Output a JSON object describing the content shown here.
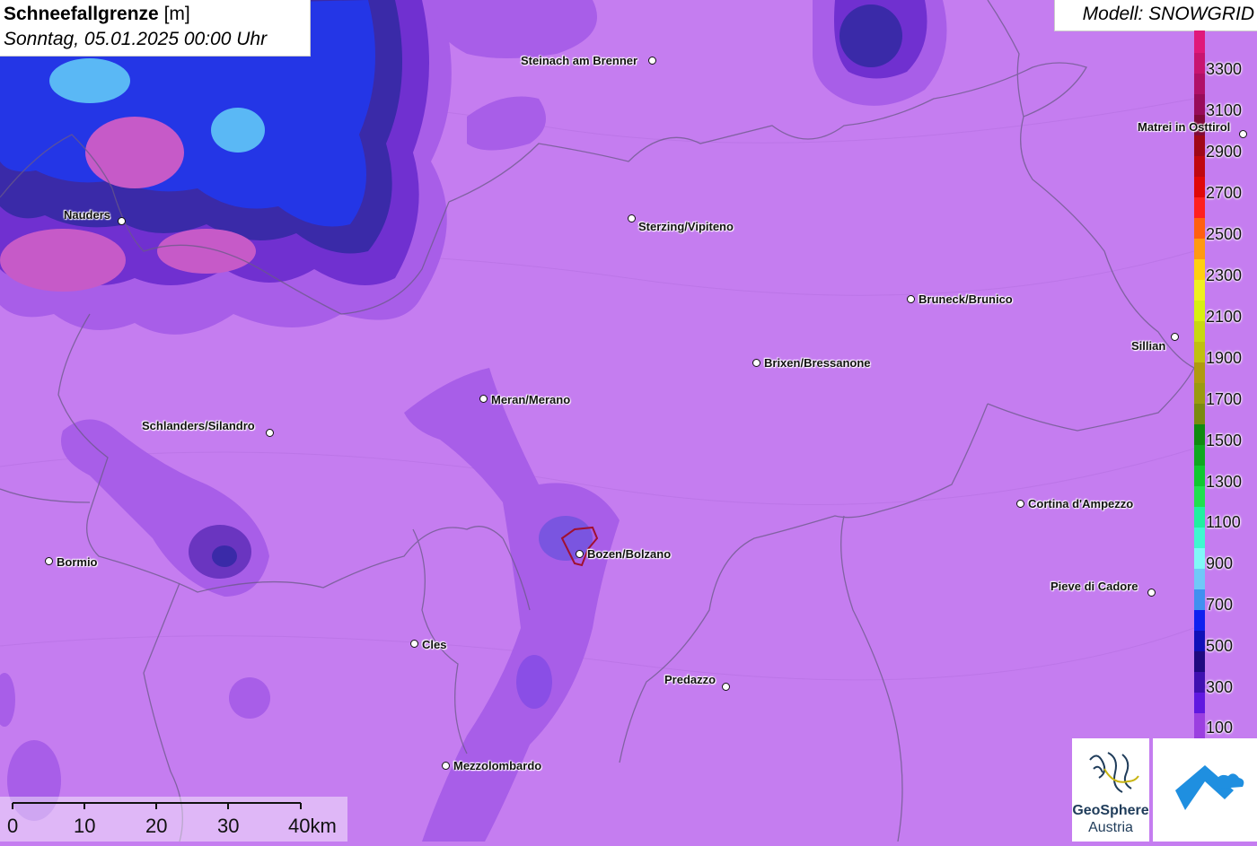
{
  "title": {
    "main": "Schneefallgrenze",
    "unit": "[m]",
    "subtitle": "Sonntag, 05.01.2025 00:00 Uhr"
  },
  "model": "Modell: SNOWGRID",
  "legend": {
    "labels": [
      "3300",
      "3100",
      "2900",
      "2700",
      "2500",
      "2300",
      "2100",
      "1900",
      "1700",
      "1500",
      "1300",
      "1100",
      "900",
      "700",
      "500",
      "300",
      "100"
    ]
  },
  "scale": {
    "labels": [
      "0",
      "10",
      "20",
      "30",
      "40km"
    ]
  },
  "towns": [
    {
      "name": "Steinach am Brenner"
    },
    {
      "name": "Matrei in Osttirol"
    },
    {
      "name": "Nauders"
    },
    {
      "name": "Sterzing/Vipiteno"
    },
    {
      "name": "Bruneck/Brunico"
    },
    {
      "name": "Sillian"
    },
    {
      "name": "Brixen/Bressanone"
    },
    {
      "name": "Meran/Merano"
    },
    {
      "name": "Schlanders/Silandro"
    },
    {
      "name": "Cortina d'Ampezzo"
    },
    {
      "name": "Bozen/Bolzano"
    },
    {
      "name": "Bormio"
    },
    {
      "name": "Pieve di Cadore"
    },
    {
      "name": "Cles"
    },
    {
      "name": "Predazzo"
    },
    {
      "name": "Mezzolombardo"
    }
  ],
  "logos": {
    "geosphere_line1": "GeoSphere",
    "geosphere_line2": "Austria"
  },
  "colors": {
    "base_fill": "#c57df0",
    "deep_purple": "#9b3fe0",
    "blue": "#2e3cf0",
    "light_blue": "#5ab8f5"
  }
}
